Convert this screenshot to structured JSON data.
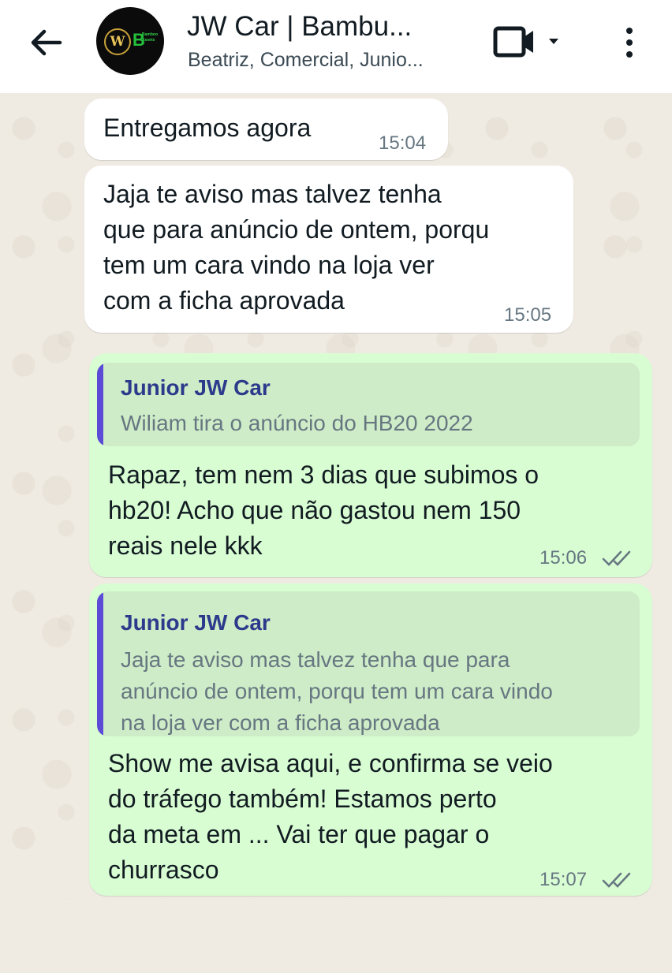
{
  "header": {
    "title": "JW Car | Bambu...",
    "subtitle": "Beatriz, Comercial, Junio...",
    "back_icon": "arrow-left-icon",
    "video_icon": "video-call-icon",
    "dropdown_icon": "chevron-down-icon",
    "menu_icon": "more-vert-icon",
    "avatar_text": {
      "letter_w": "W",
      "letter_b": "B",
      "brand_small": "Bamboo Assets"
    }
  },
  "messages": [
    {
      "direction": "incoming",
      "text": "Entregamos  agora",
      "time": "15:04"
    },
    {
      "direction": "incoming",
      "text": "Jaja te aviso mas talvez tenha\nque para anúncio de ontem, porqu\ntem um cara vindo na loja ver\ncom a ficha aprovada",
      "time": "15:05"
    },
    {
      "direction": "outgoing",
      "quote": {
        "author": "Junior JW Car",
        "text": "Wiliam tira o anúncio do HB20 2022"
      },
      "text": "Rapaz, tem nem 3 dias que subimos o\nhb20! Acho que não gastou nem 150\nreais nele kkk",
      "time": "15:06",
      "status": "read"
    },
    {
      "direction": "outgoing",
      "quote": {
        "author": "Junior JW Car",
        "text": "Jaja te aviso mas talvez tenha que para\nanúncio de ontem, porqu tem um cara vindo\nna loja ver com a ficha aprovada"
      },
      "text": "Show me avisa aqui, e confirma se veio\ndo tráfego também! Estamos perto\nda meta em ... Vai ter que pagar o\nchurrasco",
      "time": "15:07",
      "status": "read"
    }
  ],
  "colors": {
    "header_bg": "#ffffff",
    "chat_bg": "#efeae2",
    "incoming_bubble": "#ffffff",
    "outgoing_bubble": "#d9fdd3",
    "quote_bar": "#5b4bd6",
    "quote_author": "#2c3a8c",
    "tick_read": "#667781"
  }
}
